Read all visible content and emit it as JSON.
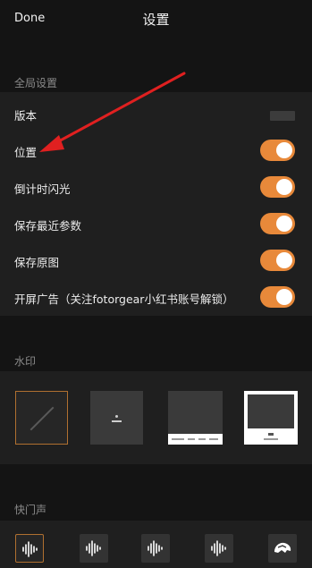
{
  "header": {
    "done_label": "Done",
    "title": "设置"
  },
  "global_settings": {
    "section_label": "全局设置",
    "version_label": "版本",
    "rows": [
      {
        "label": "位置",
        "on": true
      },
      {
        "label": "倒计时闪光",
        "on": true
      },
      {
        "label": "保存最近参数",
        "on": true
      },
      {
        "label": "保存原图",
        "on": true
      },
      {
        "label": "开屏广告（关注fotorgear小红书账号解锁）",
        "on": true
      }
    ]
  },
  "watermark": {
    "section_label": "水印",
    "options": [
      {
        "name": "none",
        "selected": true
      },
      {
        "name": "dot-caption",
        "selected": false
      },
      {
        "name": "bottom-strip",
        "selected": false
      },
      {
        "name": "white-frame",
        "selected": false
      }
    ]
  },
  "shutter_sound": {
    "section_label": "快门声",
    "options": [
      {
        "icon": "sound-wave-icon",
        "selected": true
      },
      {
        "icon": "sound-wave-icon",
        "selected": false
      },
      {
        "icon": "sound-wave-icon",
        "selected": false
      },
      {
        "icon": "sound-wave-icon",
        "selected": false
      },
      {
        "icon": "mute-shell-icon",
        "selected": false
      }
    ]
  },
  "colors": {
    "accent": "#e8893a",
    "background": "#141414",
    "panel": "#1f1f1f"
  }
}
